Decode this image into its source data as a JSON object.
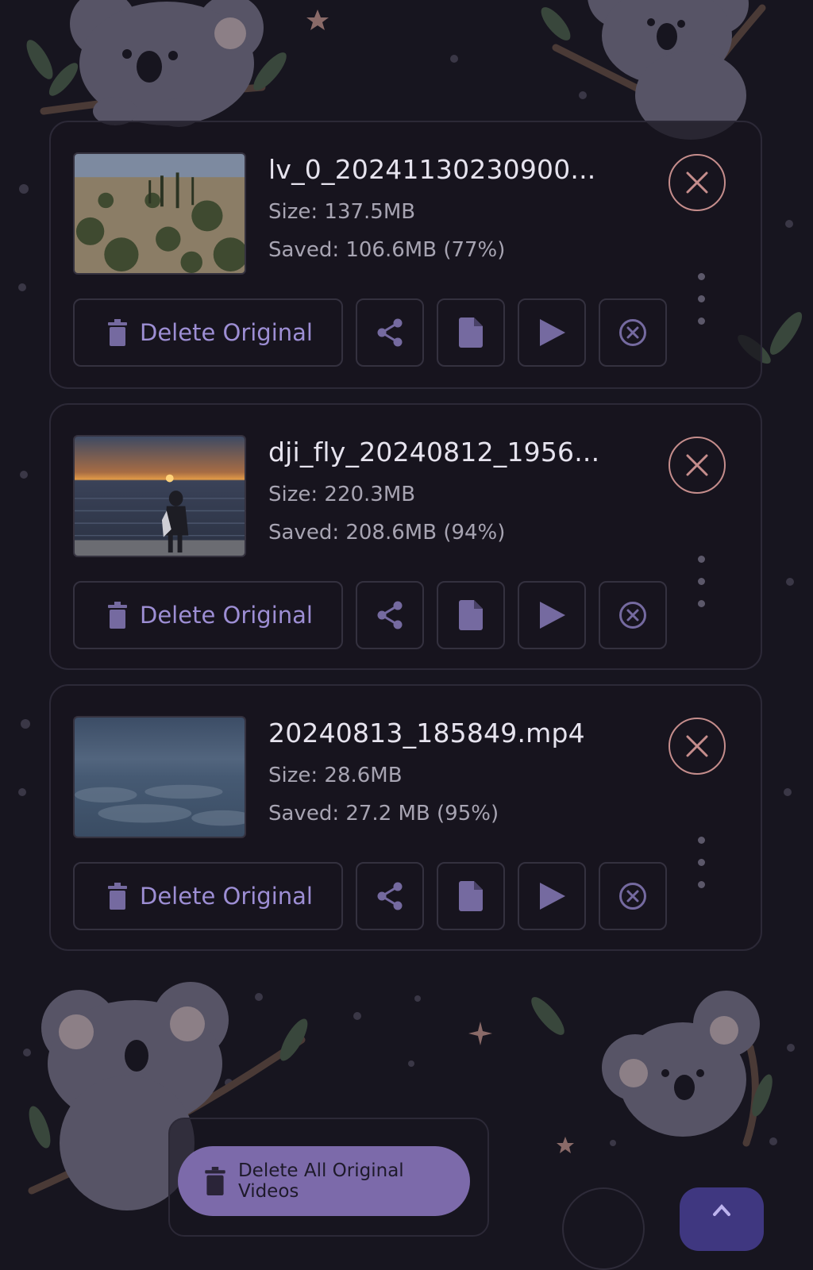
{
  "videos": [
    {
      "file_name": "lv_0_20241130230900...",
      "size": "Size: 137.5MB",
      "saved": "Saved: 106.6MB (77%)",
      "delete_original_label": "Delete Original"
    },
    {
      "file_name": "dji_fly_20240812_1956...",
      "size": "Size: 220.3MB",
      "saved": "Saved: 208.6MB  (94%)",
      "delete_original_label": "Delete Original"
    },
    {
      "file_name": "20240813_185849.mp4",
      "size": "Size: 28.6MB",
      "saved": "Saved: 27.2 MB   (95%)",
      "delete_original_label": "Delete Original"
    }
  ],
  "bottom": {
    "delete_all_label": "Delete All Original Videos"
  },
  "icons": {
    "remove": "close-icon",
    "delete": "trash-icon",
    "share": "share-icon",
    "details": "file-icon",
    "play": "play-icon",
    "cancel": "cancel-icon"
  },
  "colors": {
    "background": "#17151f",
    "accent": "#9d8ed4",
    "remove_ring": "#c58d8c",
    "primary_button": "#7c6aaa"
  }
}
